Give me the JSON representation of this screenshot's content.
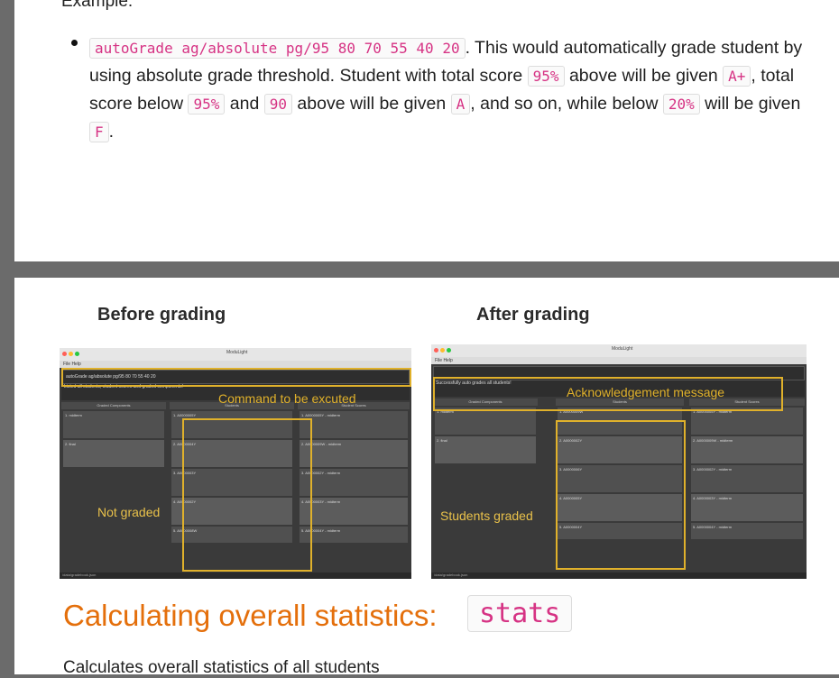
{
  "example_heading": "Example:",
  "bullet": {
    "code_command": "autoGrade ag/absolute pg/95 80 70 55 40 20",
    "t1": ". This would automatically grade student by using absolute grade threshold. Student with total score ",
    "c_95a": "95%",
    "t2": " above will be given ",
    "c_aplus": "A+",
    "t3": ", total score below ",
    "c_95b": "95%",
    "t4": " and ",
    "c_90": "90",
    "t5": " above will be given ",
    "c_a": "A",
    "t6": ", and so on, while below ",
    "c_20": "20%",
    "t7": " will be given ",
    "c_f": "F",
    "t8": "."
  },
  "figure": {
    "before_title": "Before grading",
    "after_title": "After grading",
    "before_annotation_command": "Command to be excuted",
    "before_annotation_side": "Not graded",
    "after_annotation_ack": "Acknowledgement message",
    "after_annotation_side": "Students graded",
    "app_title": "ModuLight",
    "menu": "File   Help",
    "before_command": "autoGrade ag/absolute pg/95 80 70 55 40 20",
    "before_result": "Listed all students, student scores and graded components!",
    "after_result": "Successfully auto grades all students!",
    "col_components": "Graded Components",
    "col_students": "Students",
    "col_scores": "Student Scores",
    "components": [
      "1. midterm",
      "2. final"
    ],
    "students": [
      "1. A0000005Y",
      "2. A0000004Y",
      "3. A0000003Y",
      "4. A0000002Y",
      "5. A0000008W"
    ],
    "after_students": [
      "1. A0000009W",
      "2. A0000002Y",
      "3. A0000006Y",
      "4. A0000005Y",
      "5. A0000004Y"
    ],
    "scores": [
      "1. A0000005Y - midterm",
      "2. A0000009W - midterm",
      "3. A0000002Y - midterm",
      "4. A0000003Y - midterm",
      "5. A0000004Y - midterm"
    ],
    "status": "/data/gradebook.json"
  },
  "section_heading": "Calculating overall statistics:",
  "section_code": "stats",
  "section_desc": "Calculates overall statistics of all students"
}
